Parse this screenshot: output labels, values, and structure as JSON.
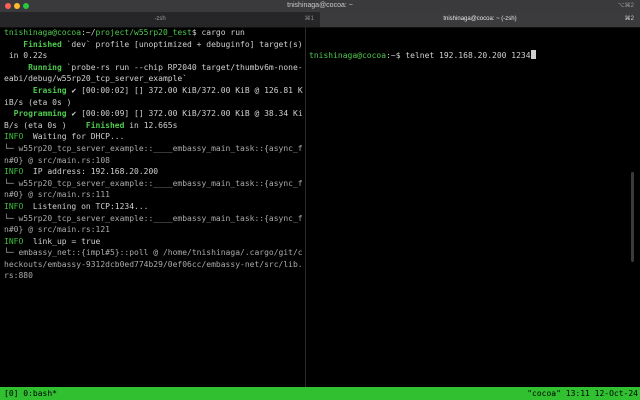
{
  "window": {
    "title": "tnishinaga@cocoa: ~",
    "shortcut": "⌥⌘2"
  },
  "tabs": [
    {
      "label": "-zsh",
      "shortcut": "⌘1"
    },
    {
      "label": "tnishinaga@cocoa: ~ (-zsh)",
      "shortcut": "⌘2"
    }
  ],
  "left_pane": {
    "lines": [
      [
        {
          "t": "tnishinaga@cocoa",
          "c": "green"
        },
        {
          "t": ":~/",
          "c": ""
        },
        {
          "t": "project/w55rp20_test",
          "c": "green"
        },
        {
          "t": "$ cargo run",
          "c": ""
        }
      ],
      [
        {
          "t": "    Finished",
          "c": "green bold"
        },
        {
          "t": " `dev` profile [unoptimized + debuginfo] target(s)",
          "c": ""
        }
      ],
      [
        {
          "t": " in 0.22s",
          "c": ""
        }
      ],
      [
        {
          "t": "     Running",
          "c": "green bold"
        },
        {
          "t": " `probe-rs run --chip RP2040 target/thumbv6m-none-",
          "c": ""
        }
      ],
      [
        {
          "t": "eabi/debug/w55rp20_tcp_server_example`",
          "c": ""
        }
      ],
      [
        {
          "t": "      Erasing",
          "c": "green bold"
        },
        {
          "t": " ✔ [00:00:02] [] 372.00 KiB/372.00 KiB @ 126.81 K",
          "c": ""
        }
      ],
      [
        {
          "t": "iB/s (eta 0s )",
          "c": ""
        }
      ],
      [
        {
          "t": "  Programming",
          "c": "green bold"
        },
        {
          "t": " ✔ [00:00:09] [] 372.00 KiB/372.00 KiB @ 38.34 Ki",
          "c": ""
        }
      ],
      [
        {
          "t": "B/s (eta 0s )",
          "c": ""
        },
        {
          "t": "    Finished",
          "c": "green bold"
        },
        {
          "t": " in 12.665s",
          "c": ""
        }
      ],
      [
        {
          "t": "INFO",
          "c": "info"
        },
        {
          "t": "  Waiting for DHCP...",
          "c": ""
        }
      ],
      [
        {
          "t": "└─ w55rp20_tcp_server_example::____embassy_main_task::{async_f",
          "c": "dim"
        }
      ],
      [
        {
          "t": "n#0} @ src/main.rs:108",
          "c": "dim"
        }
      ],
      [
        {
          "t": "INFO",
          "c": "info"
        },
        {
          "t": "  IP address: 192.168.20.200",
          "c": ""
        }
      ],
      [
        {
          "t": "└─ w55rp20_tcp_server_example::____embassy_main_task::{async_f",
          "c": "dim"
        }
      ],
      [
        {
          "t": "n#0} @ src/main.rs:111",
          "c": "dim"
        }
      ],
      [
        {
          "t": "INFO",
          "c": "info"
        },
        {
          "t": "  Listening on TCP:1234...",
          "c": ""
        }
      ],
      [
        {
          "t": "└─ w55rp20_tcp_server_example::____embassy_main_task::{async_f",
          "c": "dim"
        }
      ],
      [
        {
          "t": "n#0} @ src/main.rs:121",
          "c": "dim"
        }
      ],
      [
        {
          "t": "INFO",
          "c": "info"
        },
        {
          "t": "  link_up = true",
          "c": ""
        }
      ],
      [
        {
          "t": "└─ embassy_net::{impl#5}::poll @ /home/tnishinaga/.cargo/git/c",
          "c": "dim"
        }
      ],
      [
        {
          "t": "heckouts/embassy-9312dcb0ed774b29/0ef06cc/embassy-net/src/lib.",
          "c": "dim"
        }
      ],
      [
        {
          "t": "rs:880",
          "c": "dim"
        }
      ]
    ]
  },
  "right_pane": {
    "prompt_user": "tnishinaga@cocoa",
    "prompt_path": ":~$ ",
    "command": "telnet 192.168.20.200 1234"
  },
  "statusbar": {
    "left": "[0] 0:bash*",
    "right": "\"cocoa\" 13:11 12-Oct-24"
  }
}
